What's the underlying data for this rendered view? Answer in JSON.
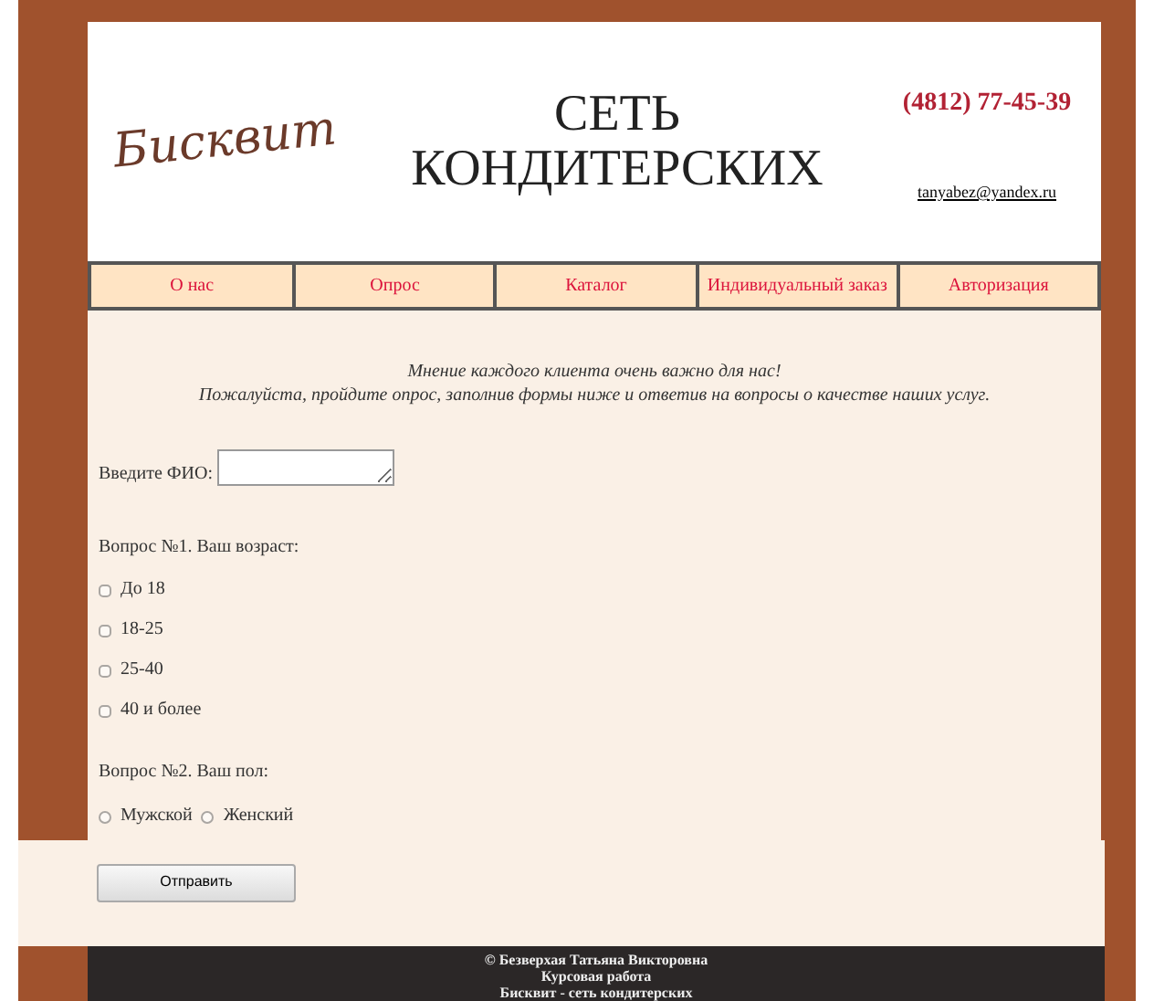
{
  "header": {
    "logo": "Бисквит",
    "title_line_1": "СЕТЬ",
    "title_line_2": "КОНДИТЕРСКИХ",
    "phone": "(4812) 77-45-39",
    "email": "tanyabez@yandex.ru"
  },
  "nav": [
    {
      "label": "О нас"
    },
    {
      "label": "Опрос"
    },
    {
      "label": "Каталог"
    },
    {
      "label": "Индивидуальный заказ"
    },
    {
      "label": "Авторизация"
    }
  ],
  "intro": [
    "Мнение каждого клиента очень важно для нас!",
    "Пожалуйста, пройдите опрос, заполнив формы ниже и ответив на вопросы о качестве наших услуг."
  ],
  "name_field": {
    "label": "Введите ФИО:"
  },
  "question_1": {
    "label": "Вопрос №1. Ваш возраст:",
    "options": [
      {
        "label": "До 18",
        "checked": false
      },
      {
        "label": "18-25",
        "checked": false
      },
      {
        "label": "25-40",
        "checked": false
      },
      {
        "label": "40 и более",
        "checked": false
      }
    ]
  },
  "question_2": {
    "label": "Вопрос №2. Ваш пол:",
    "options": [
      {
        "label": "Мужской",
        "selected": false
      },
      {
        "label": "Женский",
        "selected": false
      }
    ]
  },
  "submit_button": "Отправить",
  "footer": [
    "© Безверхая Татьяна Викторовна",
    "Курсовая работа",
    "Бисквит - сеть кондитерских"
  ]
}
